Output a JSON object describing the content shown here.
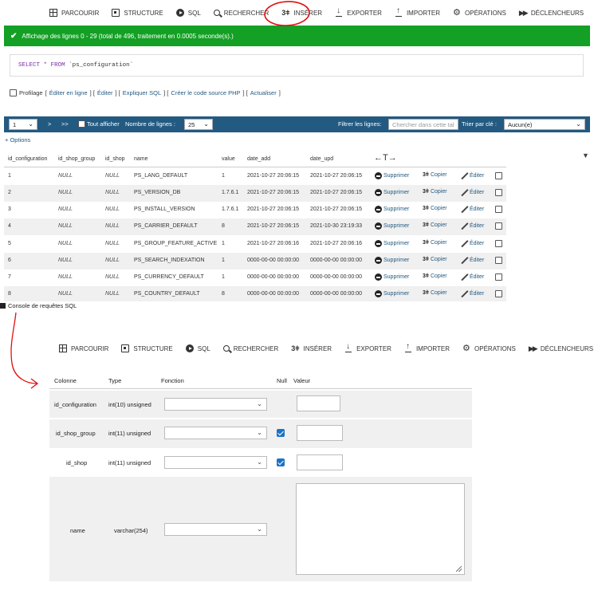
{
  "toolbar": {
    "items": [
      {
        "label": "PARCOURIR",
        "icon": "browse-grid-icon"
      },
      {
        "label": "STRUCTURE",
        "icon": "structure-icon"
      },
      {
        "label": "SQL",
        "icon": "sql-play-icon"
      },
      {
        "label": "RECHERCHER",
        "icon": "search-icon"
      },
      {
        "label": "INSÉRER",
        "icon": "insert-icon"
      },
      {
        "label": "EXPORTER",
        "icon": "export-icon"
      },
      {
        "label": "IMPORTER",
        "icon": "import-icon"
      },
      {
        "label": "OPÉRATIONS",
        "icon": "gear-icon"
      },
      {
        "label": "DÉCLENCHEURS",
        "icon": "triggers-icon"
      }
    ]
  },
  "success": {
    "message": "Affichage des lignes 0 - 29 (total de 496, traitement en 0.0005 seconde(s).)"
  },
  "sql": {
    "select": "SELECT",
    "star": "*",
    "from": "FROM",
    "table": "`ps_configuration`"
  },
  "profiling": {
    "label": "Profilage",
    "links": [
      "Éditer en ligne",
      "Éditer",
      "Expliquer SQL",
      "Créer le code source PHP",
      "Actualiser"
    ]
  },
  "nav": {
    "page": "1",
    "next": ">",
    "last": ">>",
    "show_all": "Tout afficher",
    "rows_label": "Nombre de lignes :",
    "rows_value": "25",
    "filter_label": "Filtrer les lignes:",
    "filter_placeholder": "Chercher dans cette tal",
    "sort_label": "Trier par clé :",
    "sort_value": "Aucun(e)"
  },
  "options_link": "+ Options",
  "table": {
    "columns": [
      "id_configuration",
      "id_shop_group",
      "id_shop",
      "name",
      "value",
      "date_add",
      "date_upd"
    ],
    "arrows": "←T→",
    "actions": {
      "delete": "Supprimer",
      "copy": "Copier",
      "edit": "Éditer"
    },
    "rows": [
      [
        "1",
        "NULL",
        "NULL",
        "PS_LANG_DEFAULT",
        "1",
        "2021-10-27 20:06:15",
        "2021-10-27 20:06:15"
      ],
      [
        "2",
        "NULL",
        "NULL",
        "PS_VERSION_DB",
        "1.7.6.1",
        "2021-10-27 20:06:15",
        "2021-10-27 20:06:15"
      ],
      [
        "3",
        "NULL",
        "NULL",
        "PS_INSTALL_VERSION",
        "1.7.6.1",
        "2021-10-27 20:06:15",
        "2021-10-27 20:06:15"
      ],
      [
        "4",
        "NULL",
        "NULL",
        "PS_CARRIER_DEFAULT",
        "8",
        "2021-10-27 20:06:15",
        "2021-10-30 23:19:33"
      ],
      [
        "5",
        "NULL",
        "NULL",
        "PS_GROUP_FEATURE_ACTIVE",
        "1",
        "2021-10-27 20:06:16",
        "2021-10-27 20:06:16"
      ],
      [
        "6",
        "NULL",
        "NULL",
        "PS_SEARCH_INDEXATION",
        "1",
        "0000-00-00 00:00:00",
        "0000-00-00 00:00:00"
      ],
      [
        "7",
        "NULL",
        "NULL",
        "PS_CURRENCY_DEFAULT",
        "1",
        "0000-00-00 00:00:00",
        "0000-00-00 00:00:00"
      ],
      [
        "8",
        "NULL",
        "NULL",
        "PS_COUNTRY_DEFAULT",
        "8",
        "0000-00-00 00:00:00",
        "0000-00-00 00:00:00"
      ]
    ]
  },
  "console": "Console de requêtes SQL",
  "form": {
    "headers": {
      "column": "Colonne",
      "type": "Type",
      "function": "Fonction",
      "null": "Null",
      "value": "Valeur"
    },
    "rows": [
      {
        "column": "id_configuration",
        "type": "int(10) unsigned",
        "null_checked": false
      },
      {
        "column": "id_shop_group",
        "type": "int(11) unsigned",
        "null_checked": true
      },
      {
        "column": "id_shop",
        "type": "int(11) unsigned",
        "null_checked": true
      },
      {
        "column": "name",
        "type": "varchar(254)",
        "null_checked": false
      }
    ]
  },
  "colors": {
    "success": "#13a024",
    "navbar": "#235a81",
    "annotation": "#e01010",
    "checkbox": "#1a73c4"
  }
}
